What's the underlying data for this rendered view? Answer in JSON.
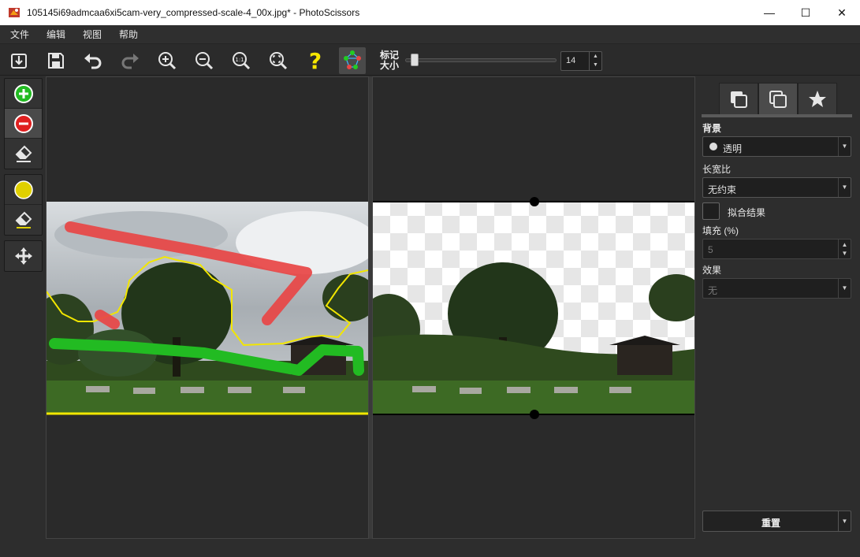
{
  "window": {
    "title": "105145i69admcaa6xi5cam-very_compressed-scale-4_00x.jpg* - PhotoScissors",
    "minimize_glyph": "—",
    "maximize_glyph": "☐",
    "close_glyph": "✕"
  },
  "menu": {
    "items": [
      {
        "label": "文件"
      },
      {
        "label": "编辑"
      },
      {
        "label": "视图"
      },
      {
        "label": "帮助"
      }
    ]
  },
  "toolbar": {
    "buttons": [
      {
        "icon": "open-icon"
      },
      {
        "icon": "save-icon"
      },
      {
        "icon": "undo-icon"
      },
      {
        "icon": "redo-icon"
      },
      {
        "icon": "zoom-in-icon"
      },
      {
        "icon": "zoom-out-icon"
      },
      {
        "icon": "zoom-1-1-icon"
      },
      {
        "icon": "fit-icon"
      },
      {
        "icon": "help-icon"
      },
      {
        "icon": "mask-points-icon"
      }
    ],
    "zoom_1_1_label": "1:1",
    "help_label": "?",
    "marker_label": "标记大小",
    "marker_size": "14",
    "marker_slider_fraction": 0.04
  },
  "palette": {
    "tools": [
      {
        "icon": "add-foreground-icon"
      },
      {
        "icon": "remove-background-icon"
      },
      {
        "icon": "eraser-icon"
      },
      {
        "icon": "edge-marker-icon"
      },
      {
        "icon": "edge-eraser-icon"
      },
      {
        "icon": "move-icon"
      }
    ]
  },
  "panel": {
    "tabs": [
      {
        "icon": "background-tab-icon"
      },
      {
        "icon": "foreground-tab-icon"
      },
      {
        "icon": "effects-tab-icon"
      }
    ],
    "background_label": "背景",
    "background_value": "透明",
    "aspect_label": "长宽比",
    "aspect_value": "无约束",
    "fit_label": "拟合结果",
    "padding_label": "填充 (%)",
    "padding_value": "5",
    "effect_label": "效果",
    "effect_value": "无",
    "reset_label": "重置"
  },
  "colors": {
    "foreground_marker": "#22bb22",
    "background_marker": "#e84545",
    "edge": "#f2e600"
  }
}
